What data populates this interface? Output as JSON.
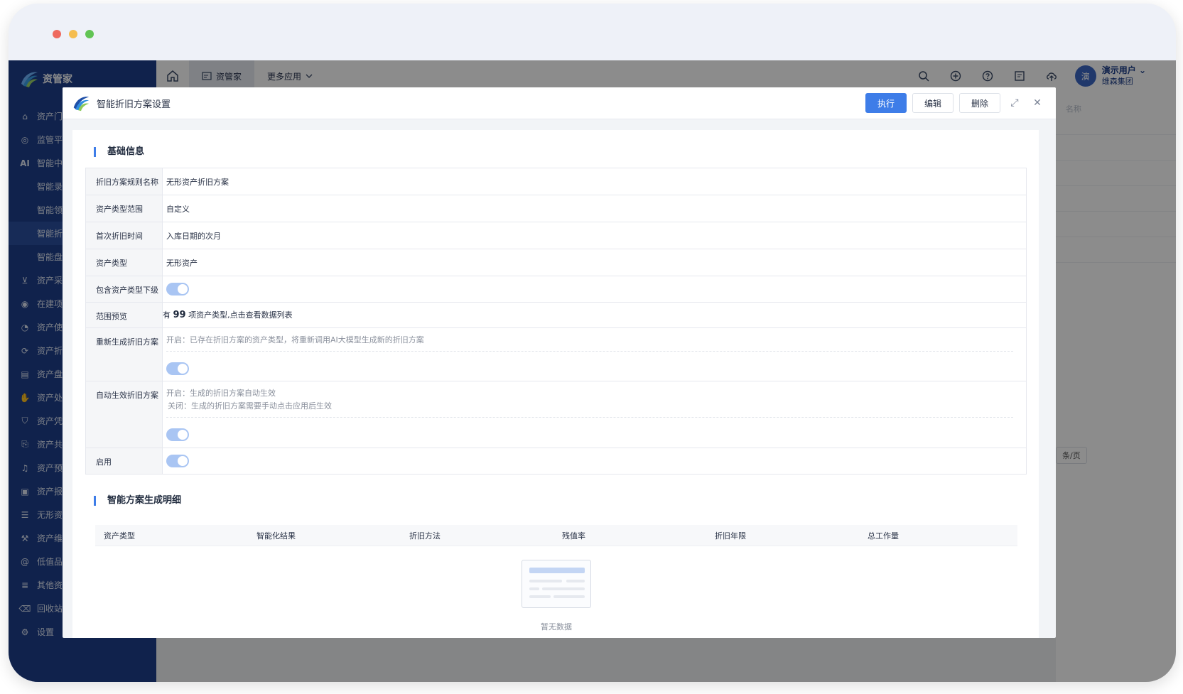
{
  "app": {
    "logo_text": "资管家",
    "top_tabs": [
      {
        "label": "资管家",
        "active": true
      },
      {
        "label": "更多应用",
        "active": false
      }
    ],
    "user": {
      "avatar_char": "演",
      "name": "演示用户",
      "org": "维森集团"
    }
  },
  "sidebar": {
    "items": [
      {
        "label": "资产门户",
        "icon": "home-icon",
        "sub": false
      },
      {
        "label": "监管平台",
        "icon": "pin-icon",
        "sub": false
      },
      {
        "label": "智能中心",
        "icon": "ai-icon",
        "sub": false
      },
      {
        "label": "智能录入",
        "icon": "",
        "sub": true
      },
      {
        "label": "智能领用",
        "icon": "",
        "sub": true
      },
      {
        "label": "智能折旧",
        "icon": "",
        "sub": true,
        "active": true
      },
      {
        "label": "智能盘点",
        "icon": "",
        "sub": true
      },
      {
        "label": "资产采购",
        "icon": "cart-icon",
        "sub": false
      },
      {
        "label": "在建项目",
        "icon": "project-icon",
        "sub": false
      },
      {
        "label": "资产使用",
        "icon": "pie-icon",
        "sub": false
      },
      {
        "label": "资产折旧",
        "icon": "cycle-icon",
        "sub": false
      },
      {
        "label": "资产盘点",
        "icon": "check-doc-icon",
        "sub": false
      },
      {
        "label": "资产处置",
        "icon": "hand-icon",
        "sub": false
      },
      {
        "label": "资产凭证",
        "icon": "shield-icon",
        "sub": false
      },
      {
        "label": "资产共享",
        "icon": "share-icon",
        "sub": false
      },
      {
        "label": "资产预警",
        "icon": "bell-icon",
        "sub": false
      },
      {
        "label": "资产报表",
        "icon": "report-icon",
        "sub": false
      },
      {
        "label": "无形资产",
        "icon": "list-icon",
        "sub": false
      },
      {
        "label": "资产维修",
        "icon": "repair-icon",
        "sub": false
      },
      {
        "label": "低值品管理",
        "icon": "at-icon",
        "sub": false
      },
      {
        "label": "其他资产",
        "icon": "stack-icon",
        "sub": false
      },
      {
        "label": "回收站",
        "icon": "trash-icon",
        "sub": false
      },
      {
        "label": "设置",
        "icon": "gear-icon",
        "sub": false
      }
    ]
  },
  "background": {
    "search_hint": "名称",
    "pager_text": "条/页"
  },
  "modal": {
    "title": "智能折旧方案设置",
    "buttons": {
      "execute": "执行",
      "edit": "编辑",
      "delete": "删除"
    },
    "section1": "基础信息",
    "section2": "智能方案生成明细",
    "form": {
      "rule_name_label": "折旧方案规则名称",
      "rule_name_value": "无形资产折旧方案",
      "scope_label": "资产类型范围",
      "scope_value": "自定义",
      "first_label": "首次折旧时间",
      "first_value": "入库日期的次月",
      "type_label": "资产类型",
      "type_value": "无形资产",
      "include_sub_label": "包含资产类型下级",
      "include_sub_on": true,
      "preview_label": "范围预览",
      "preview_prefix": "有",
      "preview_count": "99",
      "preview_suffix": "项资产类型,点击查看数据列表",
      "regen_label": "重新生成折旧方案",
      "regen_hint": "开启：已存在折旧方案的资产类型，将重新调用AI大模型生成新的折旧方案",
      "regen_on": true,
      "auto_label": "自动生效折旧方案",
      "auto_hint_on": "开启：生成的折旧方案自动生效",
      "auto_hint_off": "关闭：生成的折旧方案需要手动点击应用后生效",
      "auto_on": true,
      "enable_label": "启用",
      "enable_on": true
    },
    "table": {
      "columns": [
        "资产类型",
        "智能化结果",
        "折旧方法",
        "残值率",
        "折旧年限",
        "总工作量"
      ],
      "empty_text": "暂无数据"
    }
  },
  "colors": {
    "sidebar": "#1e3f8a",
    "primary": "#3e7de8",
    "switch_on": "#a9c5f3"
  }
}
